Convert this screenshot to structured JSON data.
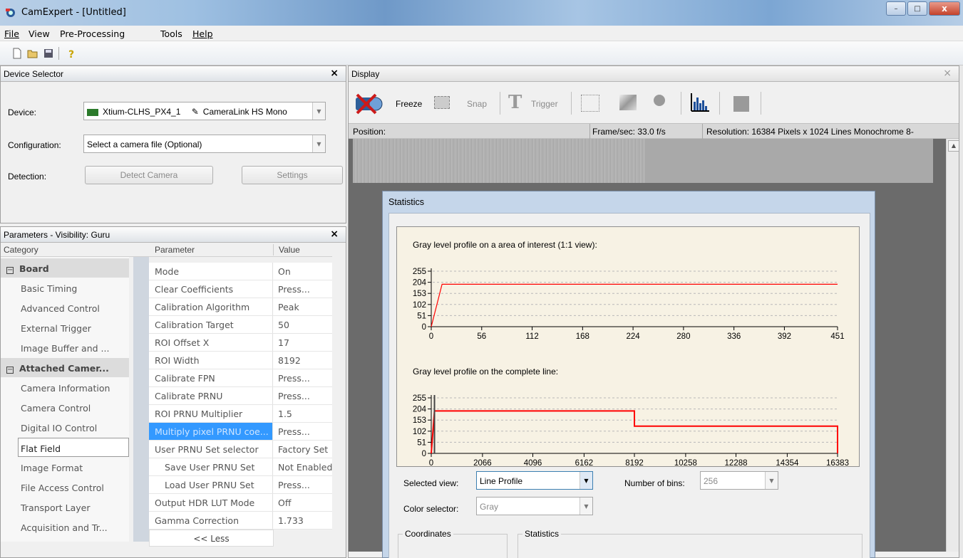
{
  "window": {
    "title": "CamExpert - [Untitled]",
    "minimize": "–",
    "maximize": "□",
    "close": "x"
  },
  "menu": [
    "File",
    "View",
    "Pre-Processing",
    "Tools",
    "Help"
  ],
  "toolbar": {
    "icons": [
      "new-icon",
      "open-icon",
      "save-icon",
      "help-icon"
    ]
  },
  "device_selector": {
    "title": "Device Selector",
    "device_label": "Device:",
    "device_value": "Xtium-CLHS_PX4_1",
    "device_value2": "CameraLink HS Mono",
    "configuration_label": "Configuration:",
    "configuration_value": "Select a camera file (Optional)",
    "detection_label": "Detection:",
    "detect_button": "Detect Camera",
    "settings_button": "Settings"
  },
  "parameters": {
    "title": "Parameters - Visibility: Guru",
    "col_category": "Category",
    "col_parameter": "Parameter",
    "col_value": "Value",
    "categories": [
      {
        "label": "Board",
        "type": "group"
      },
      {
        "label": "Basic Timing",
        "type": "item"
      },
      {
        "label": "Advanced Control",
        "type": "item"
      },
      {
        "label": "External Trigger",
        "type": "item"
      },
      {
        "label": "Image Buffer and ...",
        "type": "item"
      },
      {
        "label": "Attached Camer...",
        "type": "group"
      },
      {
        "label": "Camera Information",
        "type": "item"
      },
      {
        "label": "Camera Control",
        "type": "item"
      },
      {
        "label": "Digital IO Control",
        "type": "item"
      },
      {
        "label": "Flat Field",
        "type": "selected"
      },
      {
        "label": "Image Format",
        "type": "item"
      },
      {
        "label": "File Access Control",
        "type": "item"
      },
      {
        "label": "Transport Layer",
        "type": "item"
      },
      {
        "label": "Acquisition and Tr...",
        "type": "item"
      }
    ],
    "rows": [
      {
        "name": "Mode",
        "value": "On"
      },
      {
        "name": "Clear Coefficients",
        "value": "Press..."
      },
      {
        "name": "Calibration Algorithm",
        "value": "Peak"
      },
      {
        "name": "Calibration Target",
        "value": "50"
      },
      {
        "name": "ROI Offset X",
        "value": "17"
      },
      {
        "name": "ROI Width",
        "value": "8192"
      },
      {
        "name": "Calibrate FPN",
        "value": "Press..."
      },
      {
        "name": "Calibrate PRNU",
        "value": "Press..."
      },
      {
        "name": "ROI PRNU Multiplier",
        "value": "1.5"
      },
      {
        "name": "Multiply pixel PRNU coe...",
        "value": "Press..."
      },
      {
        "name": "User PRNU Set selector",
        "value": "Factory Set"
      },
      {
        "name": "Save User PRNU Set",
        "value": "Not Enabled"
      },
      {
        "name": "Load User PRNU Set",
        "value": "Press..."
      },
      {
        "name": "Output HDR LUT Mode",
        "value": "Off"
      },
      {
        "name": "Gamma Correction",
        "value": "1.733"
      }
    ],
    "less_button": "<< Less"
  },
  "display": {
    "title": "Display",
    "freeze": "Freeze",
    "snap": "Snap",
    "trigger": "Trigger",
    "position_label": "Position:",
    "framerate": "Frame/sec: 33.0 f/s",
    "resolution": "Resolution: 16384 Pixels x 1024 Lines  Monochrome 8-"
  },
  "statistics": {
    "title": "Statistics",
    "plot1_title": "Gray level profile on a area of interest (1:1 view):",
    "plot2_title": "Gray level profile on the complete line:",
    "selected_view_label": "Selected view:",
    "selected_view_value": "Line Profile",
    "bins_label": "Number of bins:",
    "bins_value": "256",
    "color_selector_label": "Color selector:",
    "color_selector_value": "Gray",
    "coordinates_group": "Coordinates",
    "statistics_group": "Statistics"
  },
  "colors": {
    "plot_line": "#ff0000",
    "selection": "#3399ff",
    "plot_bg": "#f7f2e4"
  },
  "chart_data": [
    {
      "type": "line",
      "title": "Gray level profile on a area of interest (1:1 view):",
      "x_ticks": [
        0,
        56,
        112,
        168,
        224,
        280,
        336,
        392,
        451
      ],
      "y_ticks": [
        0,
        51,
        102,
        153,
        204,
        255
      ],
      "xlim": [
        0,
        451
      ],
      "ylim": [
        0,
        255
      ],
      "series": [
        {
          "x": [
            0,
            12,
            451
          ],
          "y": [
            0,
            195,
            195
          ]
        }
      ]
    },
    {
      "type": "line",
      "title": "Gray level profile on the complete line:",
      "x_ticks": [
        0,
        2066,
        4096,
        6162,
        8192,
        10258,
        12288,
        14354,
        16383
      ],
      "y_ticks": [
        0,
        51,
        102,
        153,
        204,
        255
      ],
      "xlim": [
        0,
        16383
      ],
      "ylim": [
        0,
        255
      ],
      "series": [
        {
          "x": [
            0,
            130,
            8192,
            8192,
            16383,
            16383
          ],
          "y": [
            0,
            195,
            195,
            125,
            125,
            0
          ]
        }
      ]
    }
  ]
}
